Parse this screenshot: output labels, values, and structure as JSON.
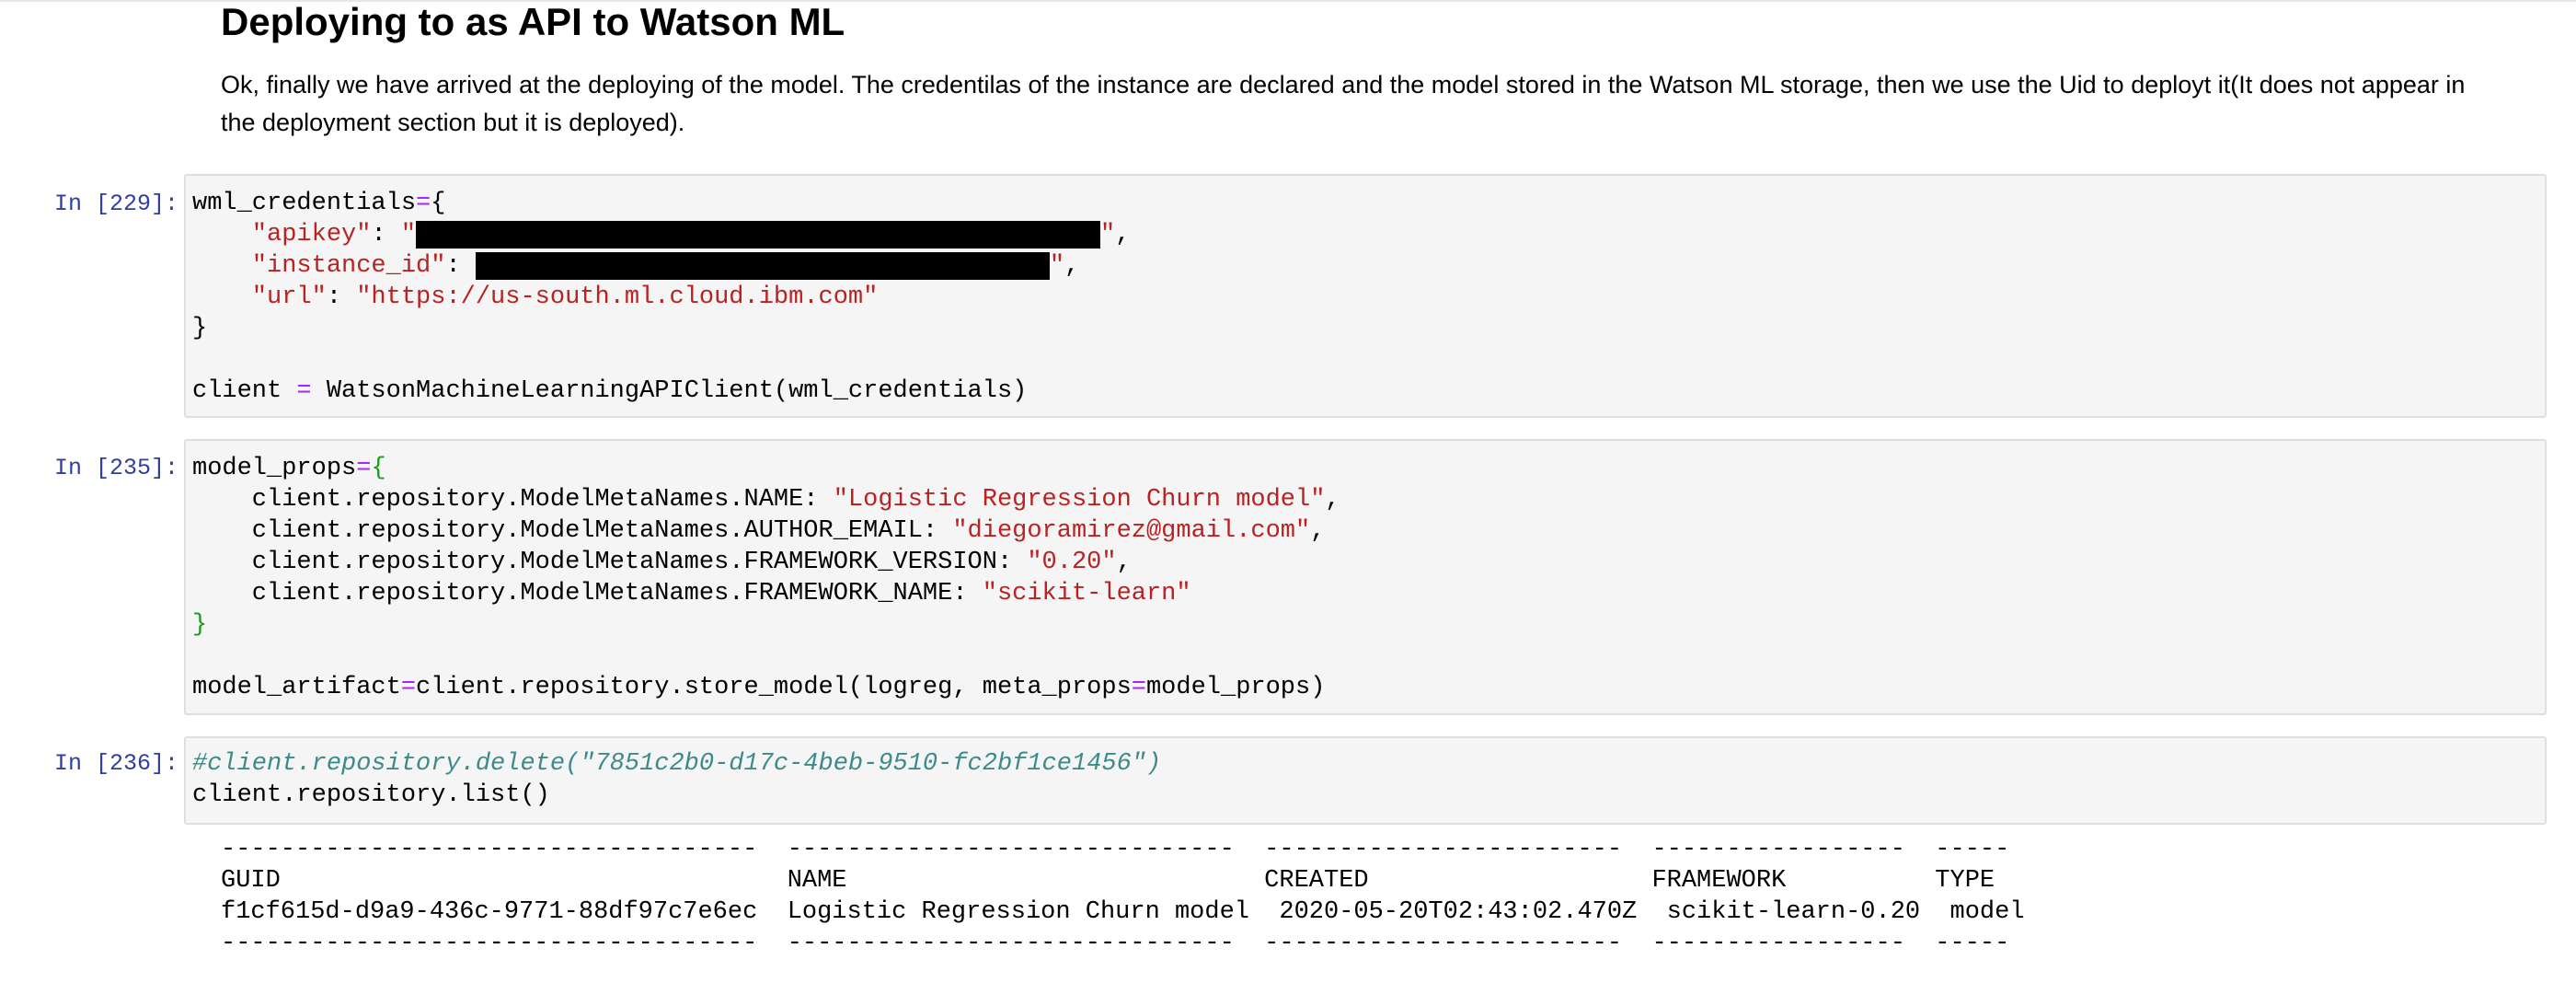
{
  "markdown": {
    "title": "Deploying to as API to Watson ML",
    "paragraph": "Ok, finally we have arrived at the deploying of the model. The credentilas of the instance are declared and the model stored in the Watson ML storage, then we use the Uid to deployt it(It does not appear in the deployment section but it is deployed)."
  },
  "cells": [
    {
      "prompt": "In [229]:",
      "lines": {
        "l1": "wml_credentials",
        "l1_op": "=",
        "l1_tail": "{",
        "apikey_key": "\"apikey\"",
        "apikey_colon": ": ",
        "apikey_open": "\"",
        "apikey_close": "\"",
        "apikey_comma": ",",
        "instance_key": "\"instance_id\"",
        "instance_colon": ": ",
        "instance_close": "\"",
        "instance_comma": ",",
        "url_key": "\"url\"",
        "url_colon": ": ",
        "url_val": "\"https://us-south.ml.cloud.ibm.com\"",
        "close": "}",
        "client_a": "client ",
        "client_op": "=",
        "client_b": " WatsonMachineLearningAPIClient(wml_credentials)"
      }
    },
    {
      "prompt": "In [235]:",
      "lines": {
        "l1": "model_props",
        "l1_op": "=",
        "l1_br": "{",
        "name_key": "    client.repository.ModelMetaNames.NAME: ",
        "name_val": "\"Logistic Regression Churn model\"",
        "email_key": "    client.repository.ModelMetaNames.AUTHOR_EMAIL: ",
        "email_val": "\"diegoramirez@gmail.com\"",
        "fv_key": "    client.repository.ModelMetaNames.FRAMEWORK_VERSION: ",
        "fv_val": "\"0.20\"",
        "fn_key": "    client.repository.ModelMetaNames.FRAMEWORK_NAME: ",
        "fn_val": "\"scikit-learn\"",
        "close_br": "}",
        "store_a": "model_artifact",
        "store_op1": "=",
        "store_b": "client.repository.store_model(logreg, meta_props",
        "store_op2": "=",
        "store_c": "model_props)",
        "comma": ","
      }
    },
    {
      "prompt": "In [236]:",
      "lines": {
        "comment": "#client.repository.delete(\"7851c2b0-d17c-4beb-9510-fc2bf1ce1456\")",
        "list": "client.repository.list()"
      }
    }
  ],
  "output": {
    "table_rule_top": "------------------------------------  ------------------------------  ------------------------  -----------------  -----",
    "header_row": "GUID                                  NAME                            CREATED                   FRAMEWORK          TYPE",
    "row_1": "f1cf615d-d9a9-436c-9771-88df97c7e6ec  Logistic Regression Churn model  2020-05-20T02:43:02.470Z  scikit-learn-0.20  model",
    "table_rule_bottom": "------------------------------------  ------------------------------  ------------------------  -----------------  -----"
  }
}
